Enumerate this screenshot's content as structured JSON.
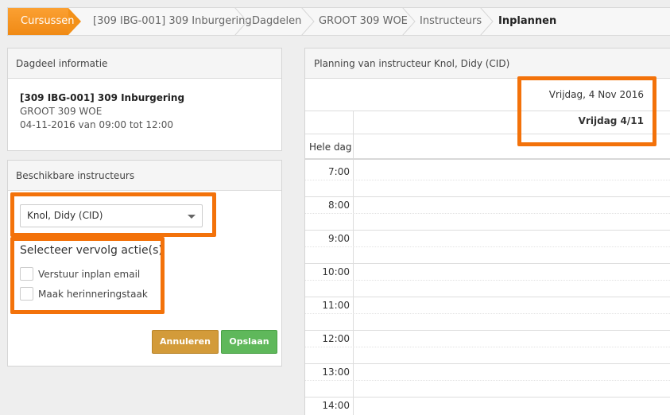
{
  "breadcrumb": {
    "items": [
      {
        "label": "Cursussen"
      },
      {
        "label": "[309 IBG-001] 309 Inburgering"
      },
      {
        "label": "Dagdelen"
      },
      {
        "label": "GROOT 309 WOE"
      },
      {
        "label": "Instructeurs"
      },
      {
        "label": "Inplannen"
      }
    ]
  },
  "dagdeel": {
    "title": "Dagdeel informatie",
    "course": "[309 IBG-001] 309 Inburgering",
    "group": "GROOT 309 WOE",
    "datetime": "04-11-2016 van 09:00 tot 12:00"
  },
  "instructeurs": {
    "title": "Beschikbare instructeurs",
    "selected": "Knol, Didy (CID)",
    "follow_title": "Selecteer vervolg actie(s)",
    "check_email": "Verstuur inplan email",
    "check_reminder": "Maak herinneringstaak",
    "cancel_label": "Annuleren",
    "save_label": "Opslaan"
  },
  "planning": {
    "title": "Planning van instructeur Knol, Didy (CID)",
    "day_full": "Vrijdag, 4 Nov 2016",
    "day_short": "Vrijdag 4/11",
    "allday_label": "Hele dag",
    "hours": [
      "7:00",
      "8:00",
      "9:00",
      "10:00",
      "11:00",
      "12:00",
      "13:00",
      "14:00"
    ]
  },
  "colors": {
    "accent": "#f39119",
    "highlight": "#f3720a",
    "cancel": "#d39b3a",
    "save": "#5fb85b"
  }
}
